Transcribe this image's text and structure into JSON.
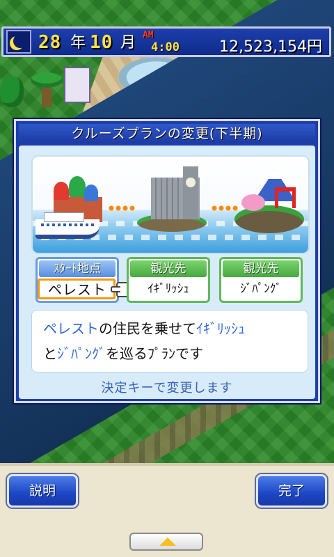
{
  "status": {
    "year": "28",
    "year_unit": "年",
    "month": "10",
    "month_unit": "月",
    "ampm": "AM",
    "time": "4:00",
    "money": "12,523,154円"
  },
  "dialog": {
    "title": "クルーズプランの変更(下半期)",
    "cards": [
      {
        "header": "ｽﾀｰﾄ地点",
        "value": "ペレスト"
      },
      {
        "header": "観光先",
        "value": "ｲｷﾞﾘｯｼｭ"
      },
      {
        "header": "観光先",
        "value": "ｼﾞﾊﾟﾝｸﾞ"
      }
    ],
    "message": {
      "line1": [
        {
          "text": "ペレスト",
          "hl": true
        },
        {
          "text": "の住民を乗せて",
          "hl": false
        },
        {
          "text": "ｲｷﾞﾘｯｼｭ",
          "hl": true
        }
      ],
      "line2": [
        {
          "text": "と",
          "hl": false
        },
        {
          "text": "ｼﾞﾊﾟﾝｸﾞ",
          "hl": true
        },
        {
          "text": "を巡るﾌﾟﾗﾝです",
          "hl": false
        }
      ]
    },
    "footer": "決定キーで変更します"
  },
  "buttons": {
    "help": "説明",
    "done": "完了"
  },
  "colors": {
    "accent_blue": "#1d3fae",
    "highlight_text": "#2c66d6",
    "gold": "#ffe14a",
    "selection_orange": "#f09a10"
  }
}
